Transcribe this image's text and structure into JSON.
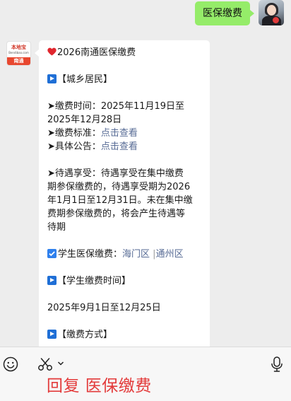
{
  "outgoing": {
    "text": "医保缴费"
  },
  "bot": {
    "brand": "本地宝",
    "site": "Bendibao.com",
    "city": "南通"
  },
  "message": {
    "title": "2026南通医保缴费",
    "section_residents": "【城乡居民】",
    "pay_time_label": "➤缴费时间：2025年11月19日至",
    "pay_time_cont": "2025年12月28日",
    "standard_label": "➤缴费标准：",
    "standard_link": "点击查看",
    "notice_label": "➤具体公告：",
    "notice_link": "点击查看",
    "waiting_lines": [
      "➤待遇享受：待遇享受在集中缴费",
      "期参保缴费的，待遇享受期为2026",
      "年1月1日至12月31日。未在集中缴",
      "费期参保缴费的，将会产生待遇等",
      "待期"
    ],
    "student_label": "学生医保缴费：",
    "student_link_1": "海门区",
    "student_sep": "|",
    "student_link_2": "通州区",
    "section_student_time": "【学生缴费时间】",
    "student_time": "2025年9月1日至12月25日",
    "section_payment": "【缴费方式】"
  },
  "reply_caption": "回复 医保缴费"
}
